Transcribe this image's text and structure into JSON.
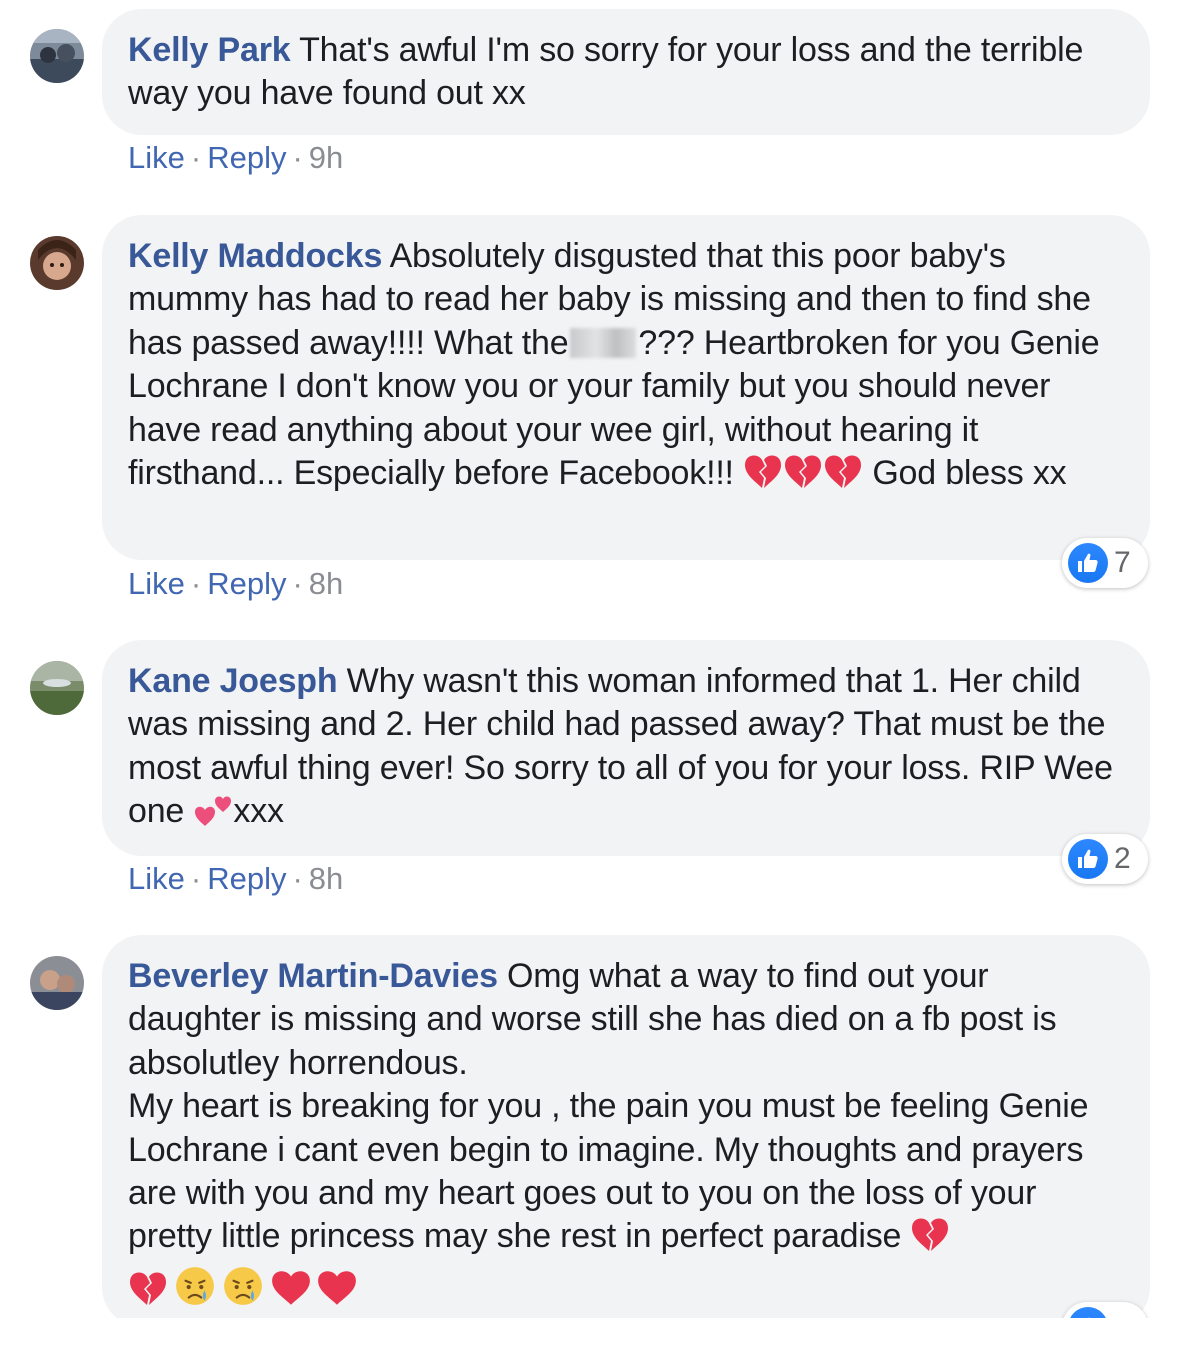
{
  "comments": [
    {
      "name": "Kelly Park",
      "text_parts": [
        "That's awful I'm so sorry for your loss and the terrible way you have found out xx"
      ],
      "actions": {
        "like": "Like",
        "reply": "Reply",
        "time": "9h"
      },
      "reaction_count": null
    },
    {
      "name": "Kelly Maddocks",
      "text_parts": [
        "Absolutely disgusted that this poor baby's mummy has had to read her baby is missing and then to find she has passed away!!!! What the",
        "??? Heartbroken for you Genie Lochrane I don't know you or your family but you should never have read anything about your wee girl, without hearing it firsthand... Especially before Facebook!!!",
        "God bless xx"
      ],
      "actions": {
        "like": "Like",
        "reply": "Reply",
        "time": "8h"
      },
      "reaction_count": "7"
    },
    {
      "name": "Kane Joesph",
      "text_parts": [
        "Why wasn't this woman informed that 1. Her child was missing and 2. Her child had passed away? That must be the most awful thing ever! So sorry to all of you for your loss. RIP Wee one",
        "xxx"
      ],
      "actions": {
        "like": "Like",
        "reply": "Reply",
        "time": "8h"
      },
      "reaction_count": "2"
    },
    {
      "name": "Beverley Martin-Davies",
      "text_parts": [
        "Omg what a way to find out your daughter is missing and worse still she has died on a fb post is absolutley horrendous.",
        "My heart is breaking for you , the pain you must be feeling Genie Lochrane i cant even begin to imagine. My thoughts and prayers are with you and my heart goes out to you on the loss of your pretty little princess may she rest in perfect paradise"
      ],
      "reaction_count": null
    }
  ],
  "icons": {
    "broken_heart": "broken-heart-icon",
    "two_hearts": "two-hearts-icon",
    "crying_face": "crying-face-icon",
    "red_heart": "red-heart-icon",
    "like": "like-thumb-icon"
  },
  "colors": {
    "name": "#385898",
    "link": "#4267b2",
    "bubble": "#f2f3f5",
    "like_blue": "#1877f2",
    "heart_red": "#e8344e"
  }
}
